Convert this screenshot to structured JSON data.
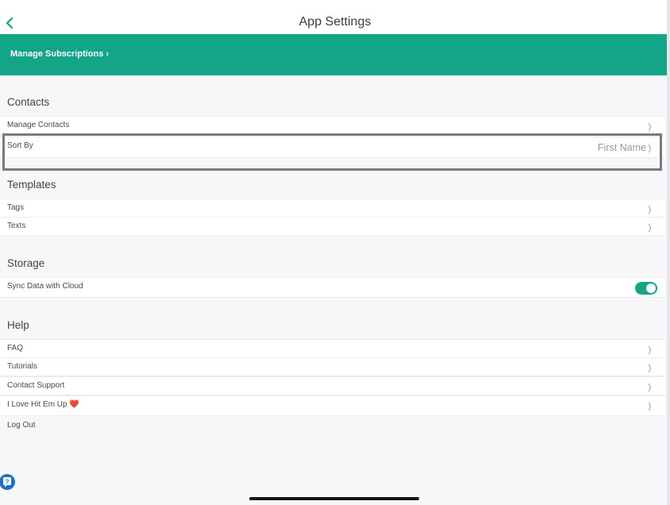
{
  "nav": {
    "title": "App Settings",
    "back_icon": "chevron-left-icon"
  },
  "banner": {
    "manage_subscriptions": "Manage Subscriptions ›",
    "color": "#12a587"
  },
  "sections": {
    "contacts": {
      "header": "Contacts",
      "manage_contacts": "Manage Contacts",
      "sort_by": "Sort By",
      "sort_by_value": "First Name"
    },
    "templates": {
      "header": "Templates",
      "tags": "Tags",
      "texts": "Texts"
    },
    "storage": {
      "header": "Storage",
      "sync": "Sync Data with Cloud",
      "sync_enabled": true
    },
    "help": {
      "header": "Help",
      "faq": "FAQ",
      "tutorials": "Tutorials",
      "contact_support": "Contact Support",
      "love": "I Love Hit Em Up ❤️",
      "logout": "Log Out"
    }
  },
  "chevron": "〉",
  "colors": {
    "accent": "#12a587",
    "highlight_border": "#7b7b7b",
    "help_fab": "#1b6fc4"
  }
}
